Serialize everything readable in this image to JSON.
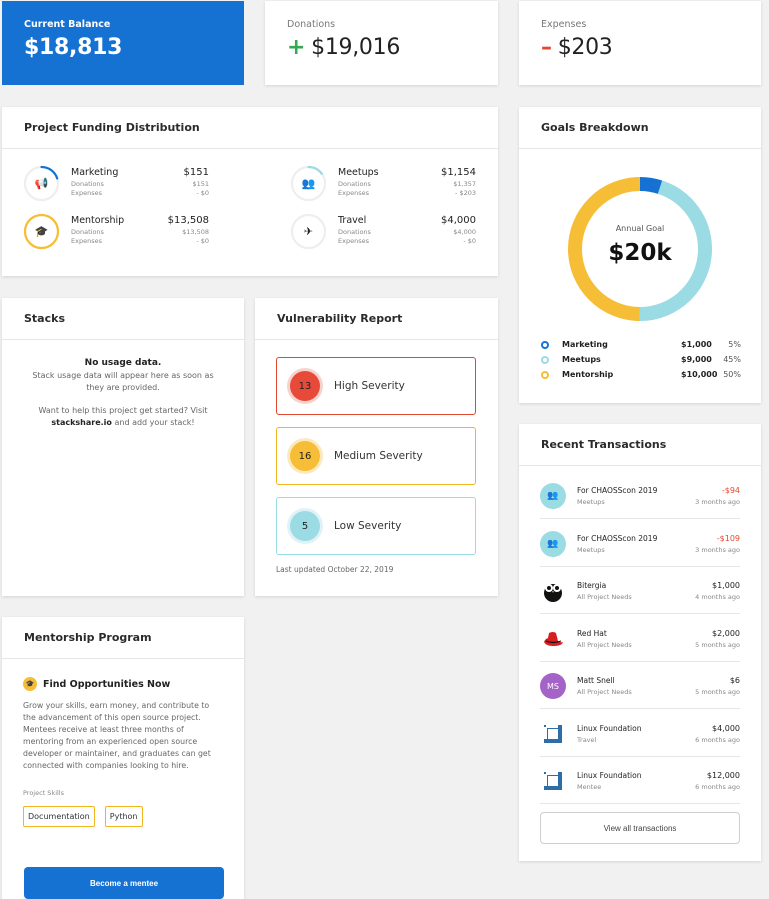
{
  "balance": {
    "label": "Current Balance",
    "value": "$18,813"
  },
  "donations": {
    "label": "Donations",
    "sign": "+",
    "value": "$19,016"
  },
  "expenses": {
    "label": "Expenses",
    "sign": "–",
    "value": "$203"
  },
  "funding": {
    "title": "Project Funding Distribution",
    "donations_label": "Donations",
    "expenses_label": "Expenses",
    "items": [
      {
        "name": "Marketing",
        "amount": "$151",
        "donations": "$151",
        "expenses": "- $0",
        "icon": "megaphone-icon",
        "glyph": "📢",
        "ring_fraction": 0.2,
        "ring_color": "#1572d3"
      },
      {
        "name": "Meetups",
        "amount": "$1,154",
        "donations": "$1,357",
        "expenses": "- $203",
        "icon": "group-icon",
        "glyph": "👥",
        "ring_fraction": 0.15,
        "ring_color": "#9bdbe4"
      },
      {
        "name": "Mentorship",
        "amount": "$13,508",
        "donations": "$13,508",
        "expenses": "- $0",
        "icon": "graduation-cap-icon",
        "glyph": "🎓",
        "ring_fraction": 1.0,
        "ring_color": "#f6be36"
      },
      {
        "name": "Travel",
        "amount": "$4,000",
        "donations": "$4,000",
        "expenses": "- $0",
        "icon": "airplane-icon",
        "glyph": "✈",
        "ring_fraction": 0.0,
        "ring_color": "#1572d3"
      }
    ]
  },
  "goals": {
    "title": "Goals Breakdown",
    "center_label": "Annual Goal",
    "center_value": "$20k",
    "items": [
      {
        "name": "Marketing",
        "amount": "$1,000",
        "percent": "5%",
        "color": "#1572d3",
        "fraction": 0.05
      },
      {
        "name": "Meetups",
        "amount": "$9,000",
        "percent": "45%",
        "color": "#9bdbe4",
        "fraction": 0.45
      },
      {
        "name": "Mentorship",
        "amount": "$10,000",
        "percent": "50%",
        "color": "#f6be36",
        "fraction": 0.5
      }
    ]
  },
  "stacks": {
    "title": "Stacks",
    "empty_title": "No usage data.",
    "empty_text": "Stack usage data will appear here as soon as they are provided.",
    "help_text": "Want to help this project get started? Visit",
    "link": "stackshare.io",
    "help_suffix": "and add your stack!"
  },
  "vulnerability": {
    "title": "Vulnerability Report",
    "items": [
      {
        "count": "13",
        "label": "High Severity",
        "color": "#e84a3a",
        "border": "#e0492f",
        "halo": "#f6d3cd"
      },
      {
        "count": "16",
        "label": "Medium Severity",
        "color": "#f6be36",
        "border": "#f2b71f",
        "halo": "#fbeac0"
      },
      {
        "count": "5",
        "label": "Low Severity",
        "color": "#9bdbe4",
        "border": "#9bdbe4",
        "halo": "#dff3f6"
      }
    ],
    "updated": "Last updated October 22, 2019"
  },
  "mentorship": {
    "title": "Mentorship Program",
    "heading": "Find Opportunities Now",
    "body": "Grow your skills, earn money, and contribute to the advancement of this open source project. Mentees receive at least three months of mentoring from an experienced open source developer or maintainer, and graduates can get connected with companies looking to hire.",
    "skills_label": "Project Skills",
    "skills": [
      "Documentation",
      "Python"
    ],
    "cta": "Become a mentee"
  },
  "transactions": {
    "title": "Recent Transactions",
    "items": [
      {
        "name": "For CHAOSScon 2019",
        "sub": "Meetups",
        "amount": "-$94",
        "negative": true,
        "time": "3 months ago",
        "avatar": "group-icon",
        "avatar_bg": "#9bdbe4",
        "avatar_text": "👥"
      },
      {
        "name": "For CHAOSScon 2019",
        "sub": "Meetups",
        "amount": "-$109",
        "negative": true,
        "time": "3 months ago",
        "avatar": "group-icon",
        "avatar_bg": "#9bdbe4",
        "avatar_text": "👥"
      },
      {
        "name": "Bitergia",
        "sub": "All Project Needs",
        "amount": "$1,000",
        "negative": false,
        "time": "4 months ago",
        "avatar": "owl-logo-icon",
        "avatar_bg": "#ffffff",
        "avatar_text": ""
      },
      {
        "name": "Red Hat",
        "sub": "All Project Needs",
        "amount": "$2,000",
        "negative": false,
        "time": "5 months ago",
        "avatar": "redhat-logo-icon",
        "avatar_bg": "#ffffff",
        "avatar_text": ""
      },
      {
        "name": "Matt Snell",
        "sub": "All Project Needs",
        "amount": "$6",
        "negative": false,
        "time": "5 months ago",
        "avatar": "user-initials-avatar",
        "avatar_bg": "#a463c6",
        "avatar_text": "MS"
      },
      {
        "name": "Linux Foundation",
        "sub": "Travel",
        "amount": "$4,000",
        "negative": false,
        "time": "6 months ago",
        "avatar": "linux-foundation-logo-icon",
        "avatar_bg": "#ffffff",
        "avatar_text": ""
      },
      {
        "name": "Linux Foundation",
        "sub": "Mentee",
        "amount": "$12,000",
        "negative": false,
        "time": "6 months ago",
        "avatar": "linux-foundation-logo-icon",
        "avatar_bg": "#ffffff",
        "avatar_text": ""
      }
    ],
    "view_all": "View all transactions"
  }
}
